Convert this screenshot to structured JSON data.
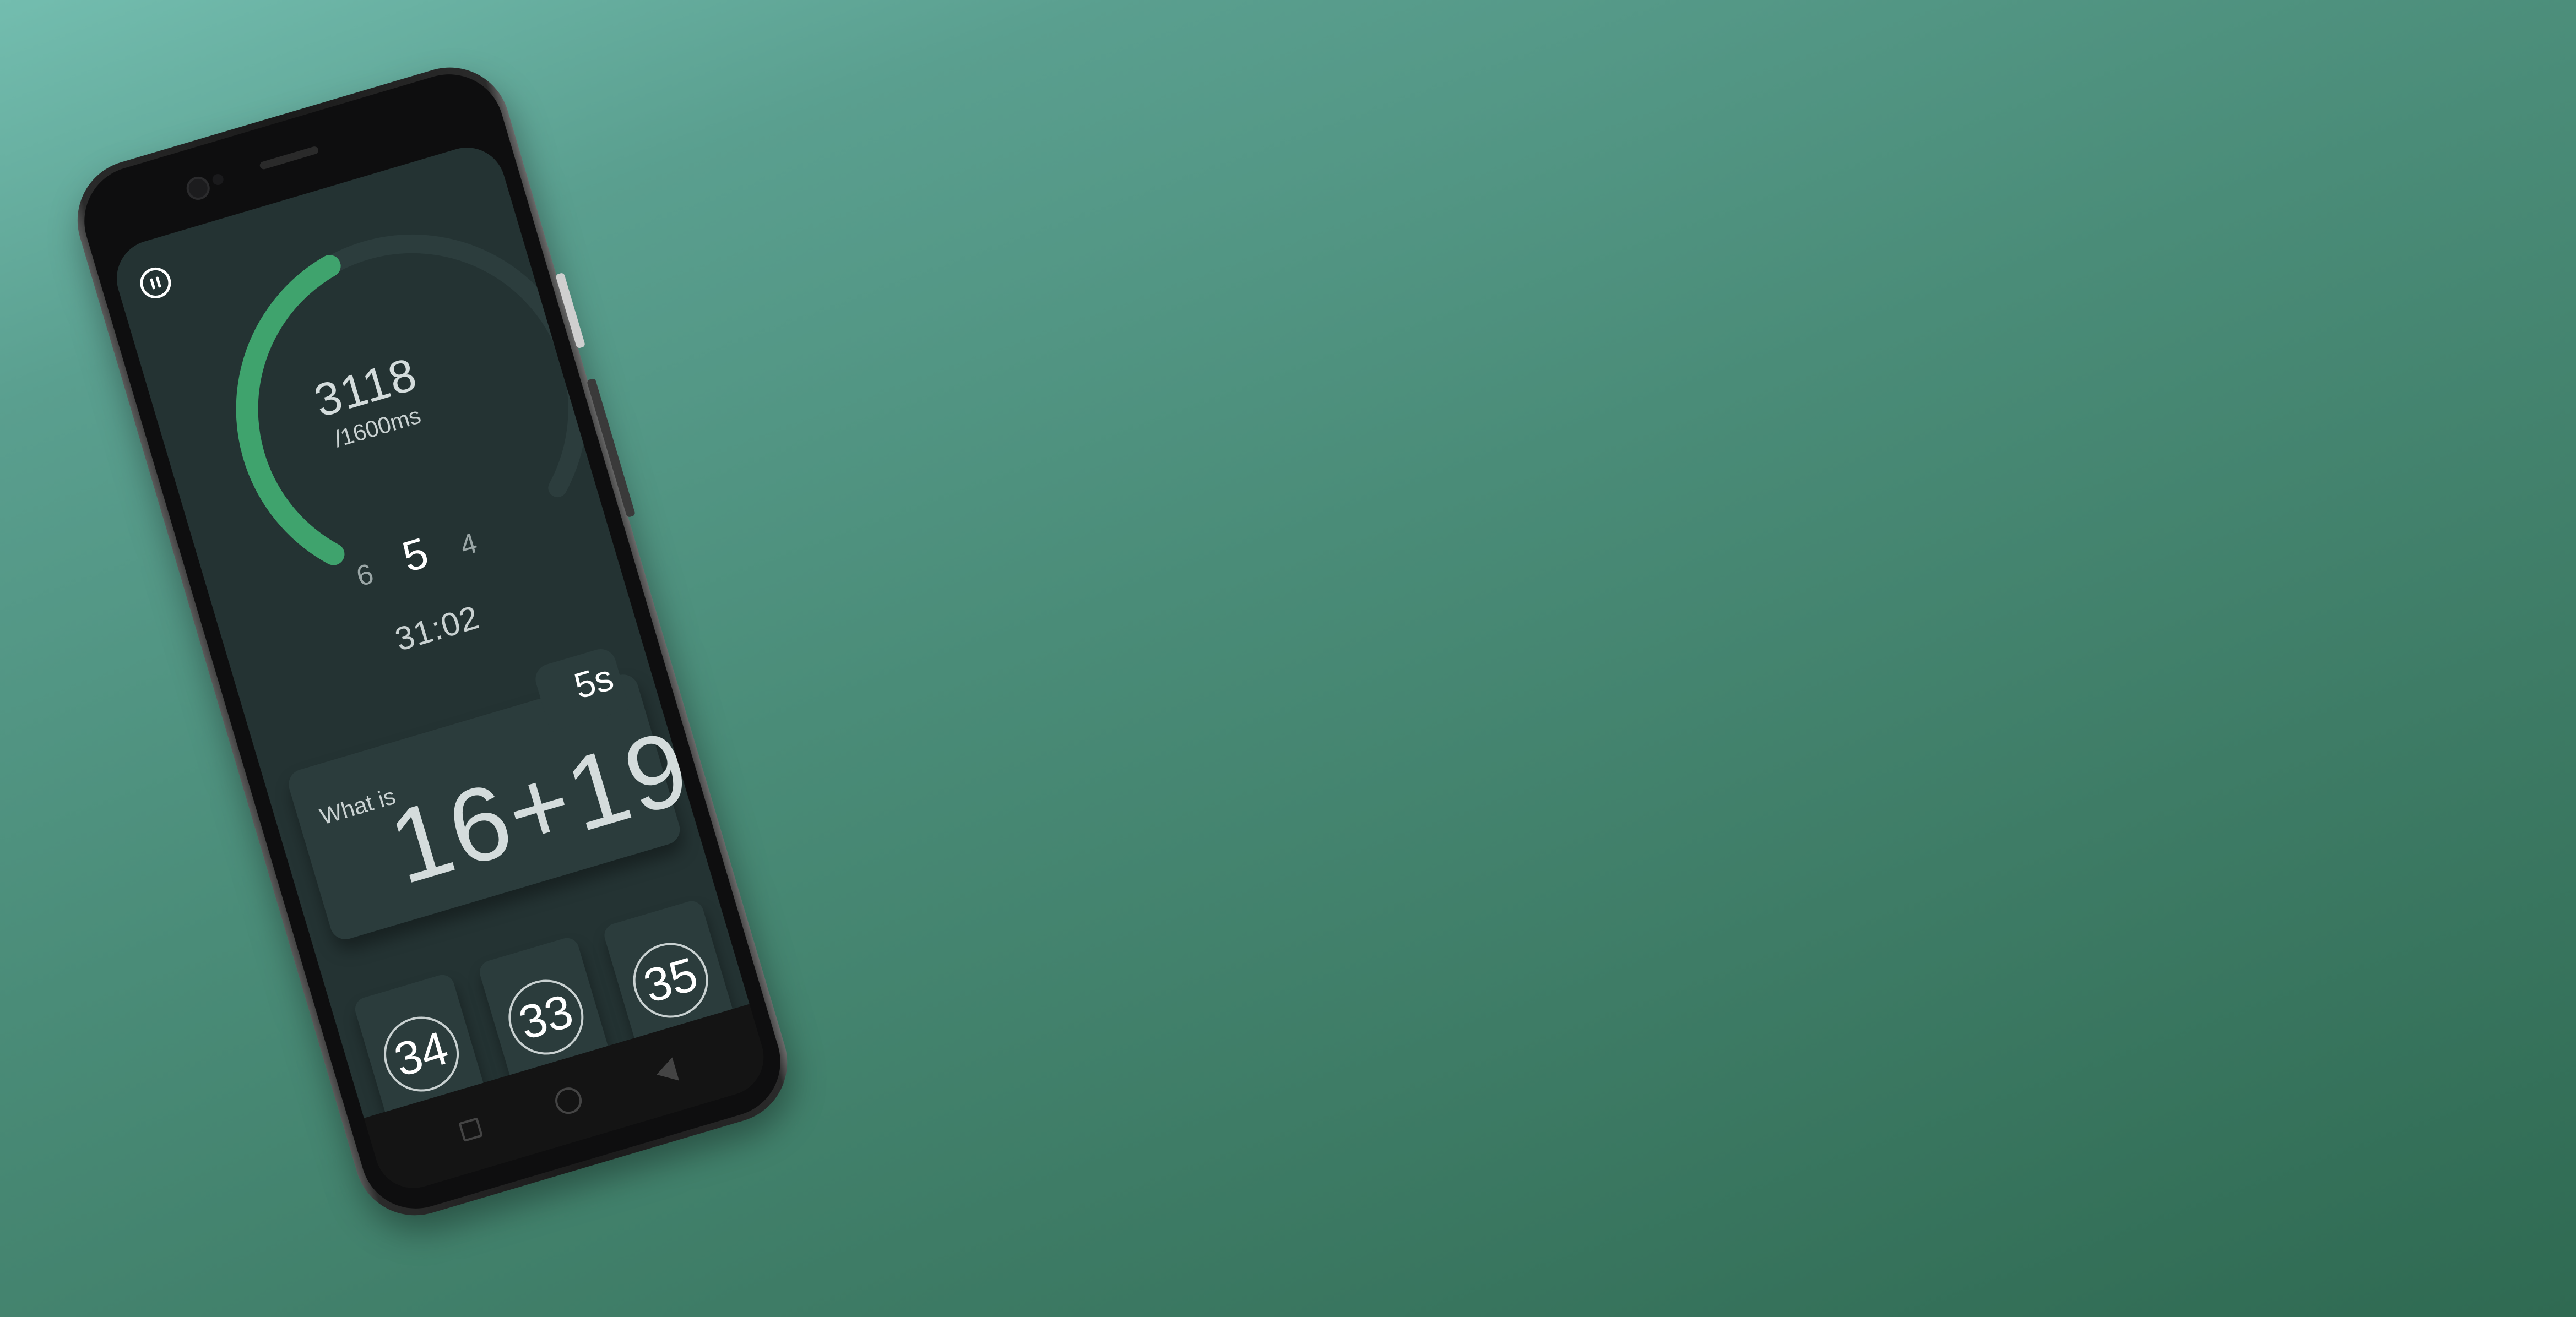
{
  "app": {
    "accent_color": "#3fa36d",
    "track_color": "#2c3d3d",
    "progress_fraction": 0.45
  },
  "header": {
    "pause_icon": "pause-icon"
  },
  "score": {
    "value": "3118",
    "subtitle": "/1600ms"
  },
  "levels": {
    "previous": "6",
    "current": "5",
    "next": "4"
  },
  "timer": {
    "value": "31:02"
  },
  "question": {
    "countdown": "5s",
    "prompt": "What is",
    "expression": "16+19"
  },
  "answers": [
    {
      "value": "34"
    },
    {
      "value": "33"
    },
    {
      "value": "35"
    }
  ],
  "nav": {
    "recents_icon": "square-icon",
    "home_icon": "circle-icon",
    "back_icon": "triangle-back-icon"
  }
}
